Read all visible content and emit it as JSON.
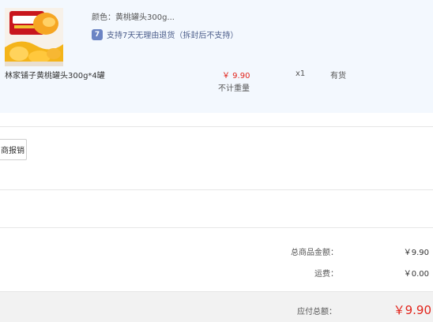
{
  "product": {
    "spec": "颜色：黄桃罐头300g...",
    "return_icon": "return-policy-icon",
    "return_icon_glyph": "7",
    "return_policy": "支持7天无理由退货（拆封后不支持）",
    "name": "林家铺子黄桃罐头300g*4罐",
    "price": "￥ 9.90",
    "weight_note": "不计重量",
    "quantity": "x1",
    "stock": "有货"
  },
  "invoice": {
    "button_label": "商报销"
  },
  "summary": {
    "goods_total_label": "总商品金额：",
    "goods_total_value": "￥9.90",
    "shipping_label": "运费：",
    "shipping_value": "￥0.00",
    "payable_label": "应付总额：",
    "payable_value": "￥9.90"
  },
  "colors": {
    "accent_red": "#e2231a",
    "panel_bg": "#f3f8fe",
    "total_bar_bg": "#f2f2f2"
  }
}
